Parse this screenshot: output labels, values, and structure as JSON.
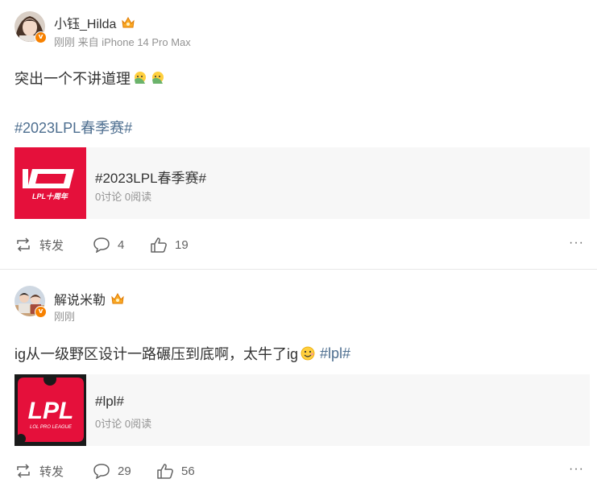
{
  "posts": [
    {
      "author": "小钰_Hilda",
      "meta": "刚刚 来自 iPhone 14 Pro Max",
      "text": "突出一个不讲道理",
      "emojis": [
        "facepalm-emoji",
        "facepalm-emoji"
      ],
      "hashtag_line": "#2023LPL春季赛#",
      "card": {
        "title": "#2023LPL春季赛#",
        "stats": "0讨论 0阅读",
        "logo_label": "LPL十周年"
      },
      "actions": {
        "repost": "转发",
        "comments": "4",
        "likes": "19"
      }
    },
    {
      "author": "解说米勒",
      "meta": "刚刚",
      "text": "ig从一级野区设计一路碾压到底啊，太牛了ig",
      "emojis": [
        "grin-emoji"
      ],
      "inline_hashtag": "#lpl#",
      "card": {
        "title": "#lpl#",
        "stats": "0讨论 0阅读",
        "logo_label": "LPL",
        "logo_sublabel": "LOL PRO LEAGUE"
      },
      "actions": {
        "repost": "转发",
        "comments": "29",
        "likes": "56"
      }
    }
  ],
  "more_label": "···",
  "verified_label": "v",
  "colors": {
    "hashtag": "#4d6e8f",
    "card_bg": "#f7f7f7",
    "lpl_red": "#e5103b",
    "verified": "#f78100"
  }
}
